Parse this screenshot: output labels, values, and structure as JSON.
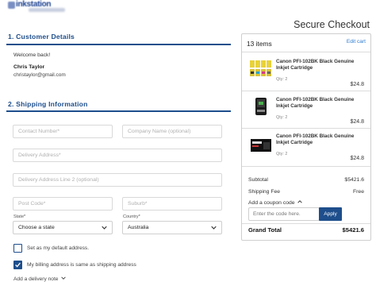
{
  "header": {
    "logo_alt": "inkstation",
    "page_heading": "Secure Checkout"
  },
  "customer": {
    "section_title": "1. Customer Details",
    "welcome": "Welcome back!",
    "name": "Chris Taylor",
    "email": "christaylor@gmail.com"
  },
  "shipping": {
    "section_title": "2. Shipping Information",
    "contact_number_placeholder": "Contact Number*",
    "company_placeholder": "Company Name (optional)",
    "address_placeholder": "Delivery Address*",
    "address2_placeholder": "Delivery Address Line 2 (optional)",
    "postcode_placeholder": "Post Code*",
    "suburb_placeholder": "Suburb*",
    "state_label": "State*",
    "state_value": "Choose a state",
    "country_label": "Country*",
    "country_value": "Australia",
    "default_address_label": "Set as my default address.",
    "default_address_checked": false,
    "billing_same_label": "My billing address is same as shipping address",
    "billing_same_checked": true,
    "delivery_note_label": "Add a delivery note"
  },
  "cart": {
    "count_label": "13 items",
    "edit_label": "Edit cart",
    "items": [
      {
        "name": "Canon PFI-102BK Black Genuine Inkjet Cartridge",
        "qty": "Qty: 2",
        "price": "$24.8"
      },
      {
        "name": "Canon PFI-102BK Black Genuine Inkjet Cartridge",
        "qty": "Qty: 2",
        "price": "$24.8"
      },
      {
        "name": "Canon PFI-102BK Black Genuine Inkjet Cartridge",
        "qty": "Qty: 2",
        "price": "$24.8"
      }
    ],
    "subtotal_label": "Subtotal",
    "subtotal_value": "$5421.6",
    "shipping_label": "Shipping Fee",
    "shipping_value": "Free",
    "coupon_label": "Add a coupon code",
    "coupon_placeholder": "Enter the code here.",
    "apply_label": "Apply",
    "total_label": "Grand Total",
    "total_value": "$5421.6"
  },
  "colors": {
    "brand_blue": "#1e4e8c",
    "link_blue": "#2b7bd0"
  }
}
